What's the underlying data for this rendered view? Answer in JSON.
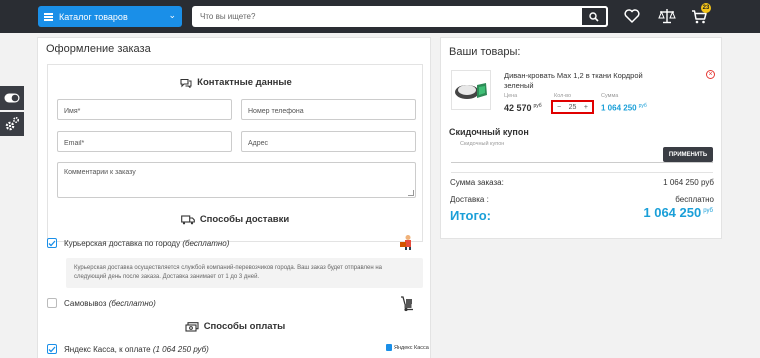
{
  "header": {
    "catalog_label": "Каталог товаров",
    "search_placeholder": "Что вы ищете?",
    "cart_count": "23"
  },
  "order": {
    "title": "Оформление заказа",
    "contact_heading": "Контактные данные",
    "fields": {
      "name": "Имя*",
      "phone": "Номер телефона",
      "email": "Email*",
      "address": "Адрес",
      "comment": "Комментарии к заказу"
    },
    "delivery_heading": "Способы доставки",
    "delivery_options": [
      {
        "label": "Курьерская доставка по городу",
        "note": "(бесплатно)",
        "checked": true
      },
      {
        "label": "Самовывоз",
        "note": "(бесплатно)",
        "checked": false
      }
    ],
    "delivery_info": "Курьерская доставка осуществляется службой компаний-перевозчиков города. Ваш заказ будет отправлен на следующий день после заказа. Доставка занимает от 1 до 3 дней.",
    "payment_heading": "Способы оплаты",
    "payment_options": [
      {
        "label": "Яндекс Касса, к оплате",
        "note": "(1 064 250 руб)",
        "checked": true,
        "logo_text": "Яндекс Касса"
      }
    ]
  },
  "cart": {
    "title": "Ваши товары:",
    "item": {
      "name": "Диван-кровать Max 1,2 в ткани Кордрой зеленый",
      "price_label": "Цена",
      "price": "42 570",
      "price_unit": "руб",
      "qty_label": "Кол-во",
      "qty": "25",
      "sum_label": "Сумма",
      "sum": "1 064 250",
      "sum_unit": "руб"
    },
    "coupon_title": "Скидочный купон",
    "coupon_placeholder": "Скидочный купон",
    "apply_label": "ПРИМЕНИТЬ",
    "order_sum_label": "Сумма заказа:",
    "order_sum": "1 064 250 руб",
    "delivery_label": "Доставка :",
    "delivery_value": "бесплатно",
    "total_label": "Итого:",
    "total": "1 064 250",
    "total_unit": "руб"
  },
  "colors": {
    "accent": "#1a8fe8",
    "price_blue": "#1a9fd8",
    "header_bg": "#2a2d33",
    "highlight": "#e00000"
  }
}
